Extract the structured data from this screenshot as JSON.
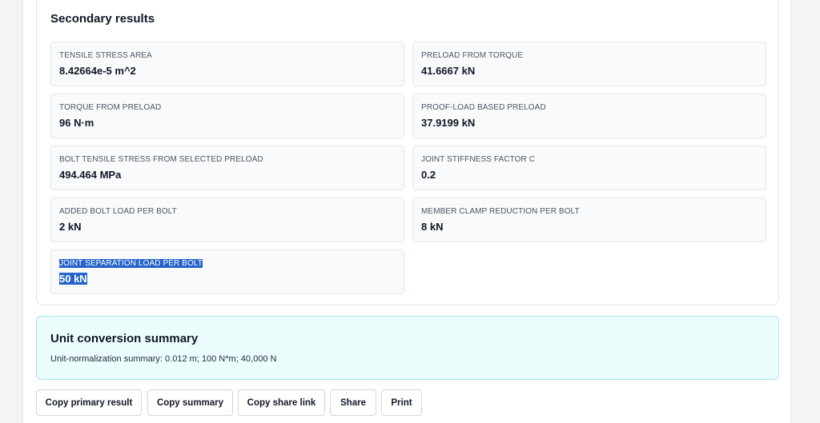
{
  "secondary": {
    "title": "Secondary results",
    "items": [
      {
        "label": "TENSILE STRESS AREA",
        "value": "8.42664e-5 m^2"
      },
      {
        "label": "PRELOAD FROM TORQUE",
        "value": "41.6667 kN"
      },
      {
        "label": "TORQUE FROM PRELOAD",
        "value": "96 N·m"
      },
      {
        "label": "PROOF-LOAD BASED PRELOAD",
        "value": "37.9199 kN"
      },
      {
        "label": "BOLT TENSILE STRESS FROM SELECTED PRELOAD",
        "value": "494.464 MPa"
      },
      {
        "label": "JOINT STIFFNESS FACTOR C",
        "value": "0.2"
      },
      {
        "label": "ADDED BOLT LOAD PER BOLT",
        "value": "2 kN"
      },
      {
        "label": "MEMBER CLAMP REDUCTION PER BOLT",
        "value": "8 kN"
      },
      {
        "label": "JOINT SEPARATION LOAD PER BOLT",
        "value": "50 kN"
      }
    ]
  },
  "unit_conversion": {
    "title": "Unit conversion summary",
    "text": "Unit-normalization summary: 0.012 m; 100 N*m; 40,000 N"
  },
  "actions": {
    "copy_primary": "Copy primary result",
    "copy_summary": "Copy summary",
    "copy_share_link": "Copy share link",
    "share": "Share",
    "print": "Print"
  },
  "colors": {
    "selection_highlight": "#2563c9",
    "info_card_bg": "#ecfdfd",
    "info_card_border": "#a5e6ec"
  }
}
